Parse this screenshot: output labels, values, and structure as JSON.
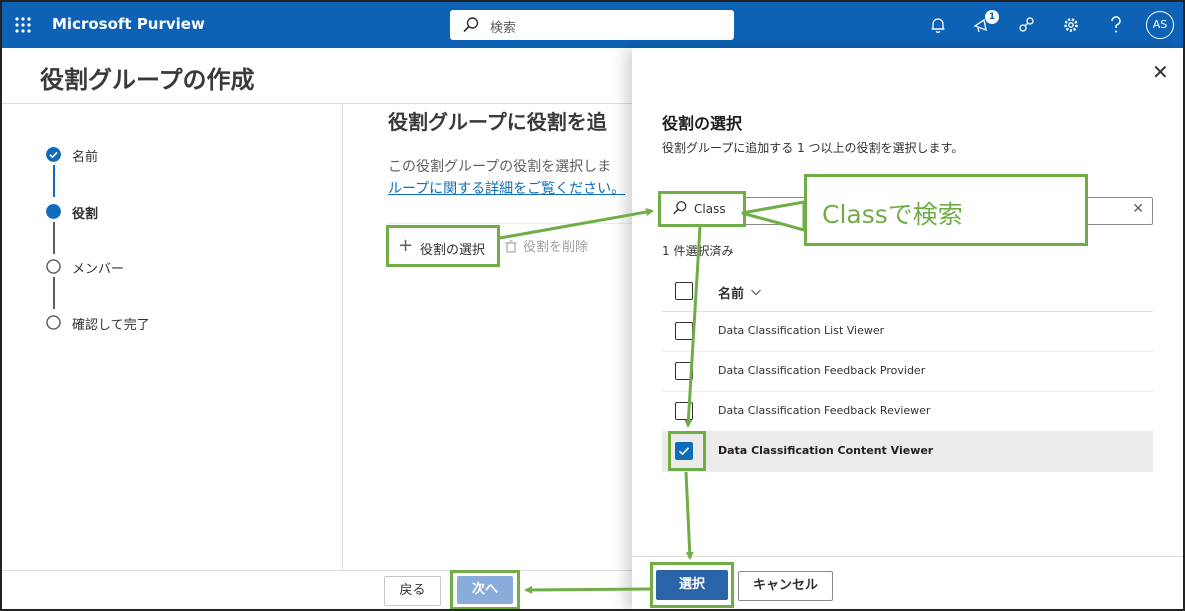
{
  "app": {
    "brand": "Microsoft Purview"
  },
  "topbar": {
    "search_placeholder": "検索",
    "notification_badge": "1",
    "avatar_initials": "AS"
  },
  "page": {
    "title": "役割グループの作成",
    "steps": [
      {
        "label": "名前",
        "state": "completed"
      },
      {
        "label": "役割",
        "state": "current"
      },
      {
        "label": "メンバー",
        "state": "pending"
      },
      {
        "label": "確認して完了",
        "state": "pending"
      }
    ],
    "section_title": "役割グループに役割を追",
    "section_desc": "この役割グループの役割を選択しま",
    "section_link": "ループに関する詳細をご覧ください。",
    "add_role_label": "役割の選択",
    "remove_role_label": "役割を削除",
    "back_label": "戻る",
    "next_label": "次へ"
  },
  "panel": {
    "title": "役割の選択",
    "subtitle": "役割グループに追加する 1 つ以上の役割を選択します。",
    "search_value": "Class",
    "selected_count": "1 件選択済み",
    "column_name": "名前",
    "rows": [
      {
        "name": "Data Classification List Viewer",
        "checked": false
      },
      {
        "name": "Data Classification Feedback Provider",
        "checked": false
      },
      {
        "name": "Data Classification Feedback Reviewer",
        "checked": false
      },
      {
        "name": "Data Classification Content Viewer",
        "checked": true
      }
    ],
    "select_label": "選択",
    "cancel_label": "キャンセル"
  },
  "callout": {
    "text": "Classで検索"
  },
  "colors": {
    "topbar": "#0e62b6",
    "accent": "#0f6cbd",
    "annotation": "#70ad47"
  }
}
